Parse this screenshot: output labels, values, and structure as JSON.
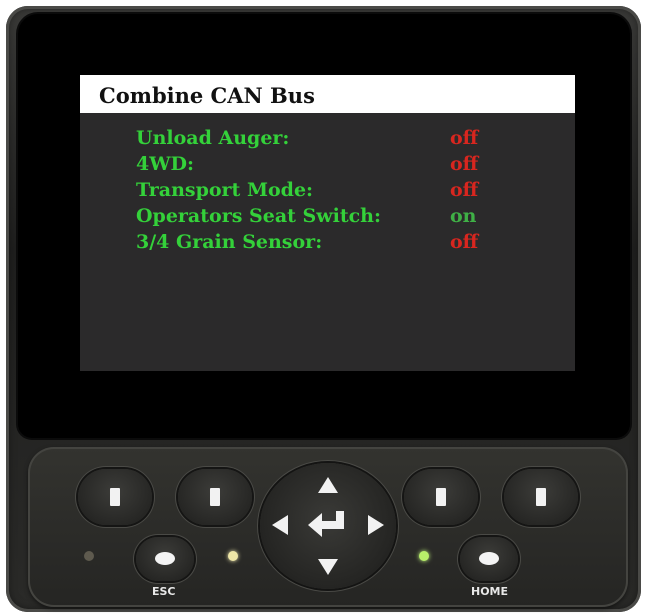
{
  "screen": {
    "title": "Combine CAN Bus",
    "rows": [
      {
        "label": "Unload Auger:",
        "value": "off"
      },
      {
        "label": "4WD:",
        "value": "off"
      },
      {
        "label": "Transport Mode:",
        "value": "off"
      },
      {
        "label": "Operators Seat Switch:",
        "value": "on"
      },
      {
        "label": "3/4 Grain Sensor:",
        "value": "off"
      }
    ]
  },
  "keypad": {
    "esc_label": "ESC",
    "home_label": "HOME",
    "icons": [
      "function-key-icon",
      "arrow-up-icon",
      "arrow-down-icon",
      "arrow-left-icon",
      "arrow-right-icon",
      "enter-icon"
    ]
  },
  "colors": {
    "label_green": "#34d13a",
    "off_red": "#d8261f",
    "on_green": "#3fb046",
    "screen_bg": "#2b2a2b"
  }
}
